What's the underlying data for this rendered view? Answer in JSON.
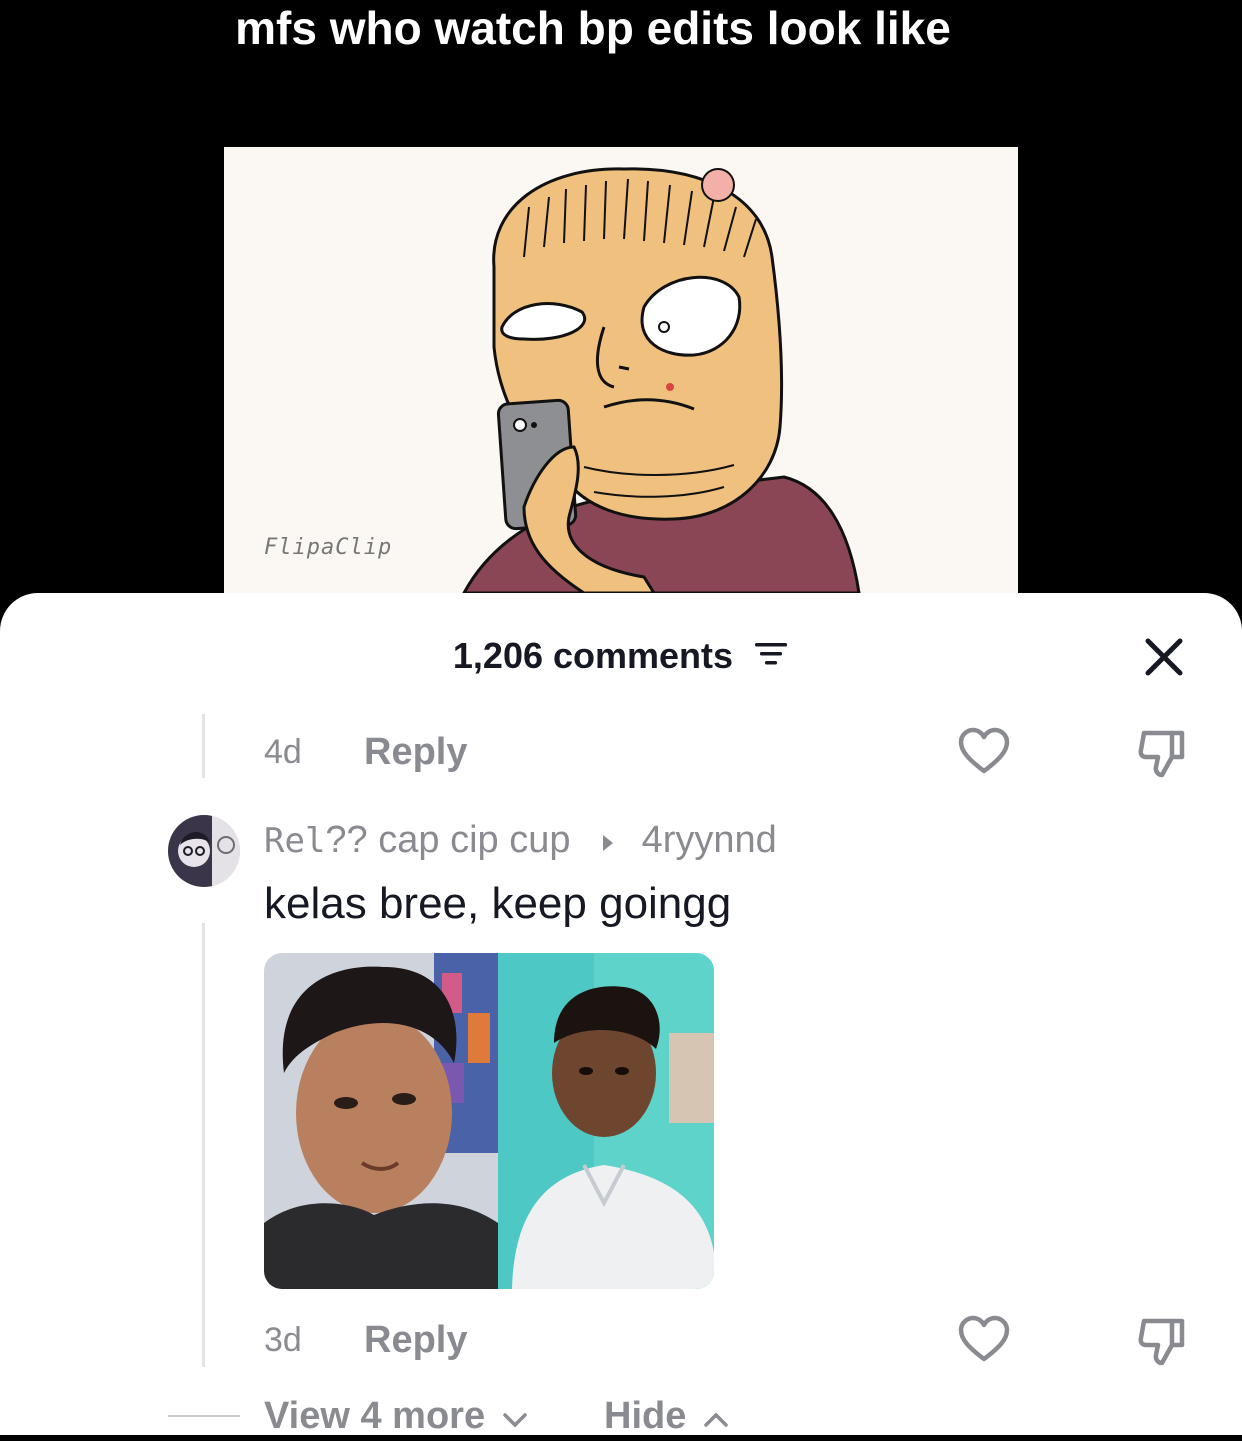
{
  "video": {
    "caption": "mfs who watch bp edits look like",
    "watermark": "FlipaClip"
  },
  "comments_panel": {
    "count_label": "1,206 comments",
    "filter_icon": "filter-lines-icon",
    "close_icon": "close-x-icon"
  },
  "previous_comment": {
    "time": "4d",
    "reply_label": "Reply"
  },
  "reply_comment": {
    "author_mono": "Rel",
    "author_rest": "?? cap cip cup",
    "reply_to": "4ryynnd",
    "text": "kelas bree, keep goingg",
    "time": "3d",
    "reply_label": "Reply"
  },
  "thread_controls": {
    "view_more_label": "View 4 more",
    "hide_label": "Hide"
  },
  "colors": {
    "secondary_text": "#8a8b91",
    "primary_text": "#161823",
    "sheet_bg": "#ffffff",
    "video_bg": "#000000"
  }
}
